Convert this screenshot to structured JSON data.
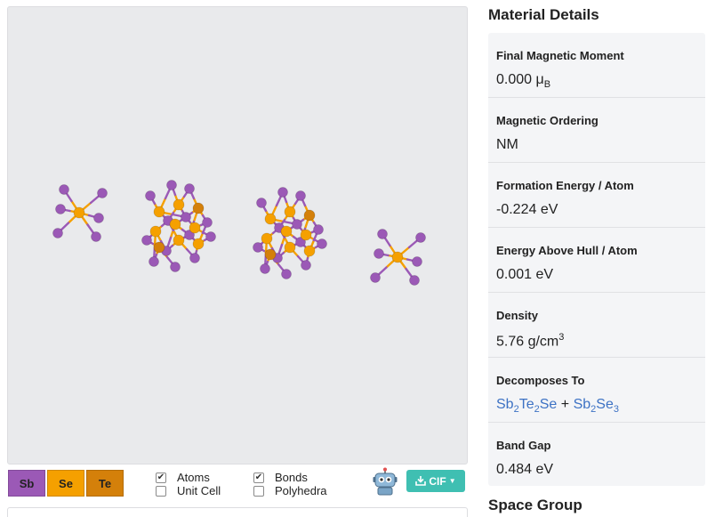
{
  "legend": [
    {
      "symbol": "Sb",
      "color": "#9b59b6"
    },
    {
      "symbol": "Se",
      "color": "#f5a000"
    },
    {
      "symbol": "Te",
      "color": "#d4800a"
    }
  ],
  "toggles": {
    "atoms": {
      "label": "Atoms",
      "checked": true
    },
    "unit_cell": {
      "label": "Unit Cell",
      "checked": false
    },
    "bonds": {
      "label": "Bonds",
      "checked": true
    },
    "polyhedra": {
      "label": "Polyhedra",
      "checked": false
    }
  },
  "download": {
    "label": "CIF"
  },
  "material_details": {
    "title": "Material Details",
    "rows": [
      {
        "label": "Final Magnetic Moment",
        "value": "0.000 μ",
        "sub": "B"
      },
      {
        "label": "Magnetic Ordering",
        "value": "NM"
      },
      {
        "label": "Formation Energy / Atom",
        "value": "-0.224 eV"
      },
      {
        "label": "Energy Above Hull / Atom",
        "value": "0.001 eV"
      },
      {
        "label": "Density",
        "value": "5.76 g/cm",
        "sup": "3"
      },
      {
        "label": "Decomposes To",
        "formula_a": [
          "Sb",
          "2",
          "Te",
          "2",
          "Se"
        ],
        "plus": "+",
        "formula_b": [
          "Sb",
          "2",
          "Se",
          "3"
        ]
      },
      {
        "label": "Band Gap",
        "value": "0.484 eV"
      }
    ]
  },
  "space_group": {
    "title": "Space Group"
  },
  "colors": {
    "sb": "#9b59b6",
    "se": "#f5a000",
    "te": "#d4800a",
    "accent": "#3fbfb2",
    "link": "#3d72c4"
  }
}
